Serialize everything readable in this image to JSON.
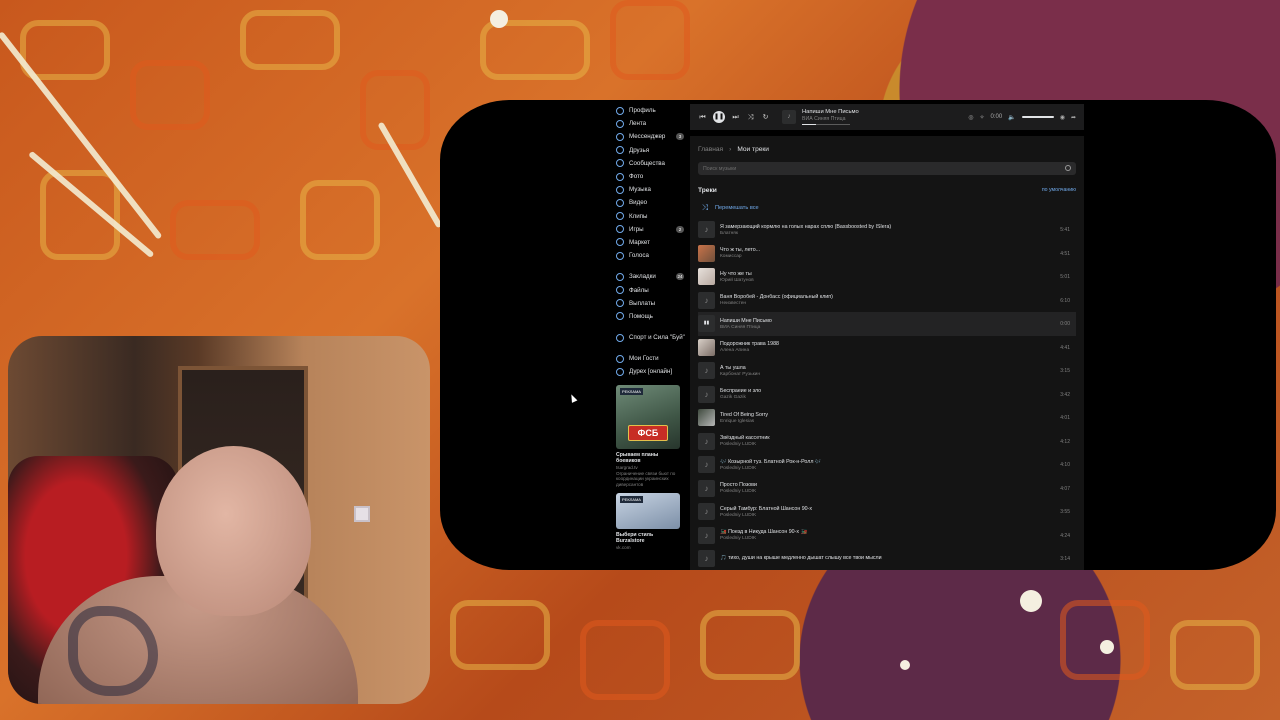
{
  "player": {
    "title": "Напиши Мне Письмо",
    "artist": "ВИА Синяя Птица",
    "time": "0:00",
    "progress": 0.3,
    "volume": 0.9
  },
  "nav": {
    "items": [
      {
        "label": "Профиль",
        "icon": "profile-icon",
        "count": ""
      },
      {
        "label": "Лента",
        "icon": "feed-icon",
        "count": ""
      },
      {
        "label": "Мессенджер",
        "icon": "messenger-icon",
        "count": "3"
      },
      {
        "label": "Друзья",
        "icon": "friends-icon",
        "count": ""
      },
      {
        "label": "Сообщества",
        "icon": "communities-icon",
        "count": ""
      },
      {
        "label": "Фото",
        "icon": "photo-icon",
        "count": ""
      },
      {
        "label": "Музыка",
        "icon": "music-icon",
        "count": ""
      },
      {
        "label": "Видео",
        "icon": "video-icon",
        "count": ""
      },
      {
        "label": "Клипы",
        "icon": "clips-icon",
        "count": ""
      },
      {
        "label": "Игры",
        "icon": "games-icon",
        "count": "2"
      },
      {
        "label": "Маркет",
        "icon": "market-icon",
        "count": ""
      },
      {
        "label": "Голоса",
        "icon": "votes-icon",
        "count": ""
      }
    ],
    "items2": [
      {
        "label": "Закладки",
        "icon": "bookmarks-icon",
        "count": "24"
      },
      {
        "label": "Файлы",
        "icon": "files-icon",
        "count": ""
      },
      {
        "label": "Выплаты",
        "icon": "payments-icon",
        "count": ""
      },
      {
        "label": "Помощь",
        "icon": "help-icon",
        "count": ""
      }
    ],
    "group1": {
      "label": "Спорт и Сила \"Буй\"",
      "icon": "group-icon"
    },
    "group2": [
      {
        "label": "Мои Гости",
        "icon": "app-icon"
      },
      {
        "label": "Дурех [онлайн]",
        "icon": "app-icon"
      }
    ]
  },
  "ads": [
    {
      "badge": "РЕКЛАМА",
      "image_text": "ФСБ",
      "title": "Срываем планы боевиков",
      "source": "tsargrad.tv",
      "desc": "Ограничение связи бьют по координации украинских диверсантов"
    },
    {
      "badge": "РЕКЛАМА",
      "title": "Выбери стиль Burzalstore",
      "source": "vk.com"
    }
  ],
  "breadcrumb": {
    "home": "Главная",
    "current": "Мои треки"
  },
  "search": {
    "placeholder": "Поиск музыки"
  },
  "section": {
    "title": "Треки",
    "sort": "по умолчанию"
  },
  "shuffle_label": "Перемешать все",
  "tracks": [
    {
      "title": "Я замерзающий кормлю на голых нарах сплю (Bassboosted by ISlera)",
      "artist": "Блатняк",
      "duration": "5:41",
      "cover": "note"
    },
    {
      "title": "Что ж ты, лето...",
      "artist": "Комиссар",
      "duration": "4:51",
      "cover": "img1"
    },
    {
      "title": "Ну что же ты",
      "artist": "Юрий Шатунов",
      "duration": "5:01",
      "cover": "img2"
    },
    {
      "title": "Ваня Воробей - Донбасс (официальный клип)",
      "artist": "Неизвестен",
      "duration": "6:10",
      "cover": "note"
    },
    {
      "title": "Напиши Мне Письмо",
      "artist": "ВИА Синяя Птица",
      "duration": "0:00",
      "cover": "playing",
      "active": true
    },
    {
      "title": "Подорожник трава 1988",
      "artist": "Алена Апина",
      "duration": "4:41",
      "cover": "img3"
    },
    {
      "title": "А ты ушла",
      "artist": "Карбонат Рузькин",
      "duration": "3:15",
      "cover": "note"
    },
    {
      "title": "Беспраеие и зло",
      "artist": "Gazik Gazik",
      "duration": "3:42",
      "cover": "note"
    },
    {
      "title": "Tired Of Being Sorry",
      "artist": "Enrique Iglesias",
      "duration": "4:01",
      "cover": "img4"
    },
    {
      "title": "Звёздный кассетник",
      "artist": "Posledniy LUDIK",
      "duration": "4:12",
      "cover": "note"
    },
    {
      "title": "🎶 Козырной туз. Блатной Рок-н-Ролл 🎶",
      "artist": "Posledniy LUDIK",
      "duration": "4:10",
      "cover": "note"
    },
    {
      "title": "Просто Позови",
      "artist": "Posledniy LUDIK",
      "duration": "4:07",
      "cover": "note"
    },
    {
      "title": "Серый Тамбур: Блатной Шансон 90-х",
      "artist": "Posledniy LUDIK",
      "duration": "3:55",
      "cover": "note"
    },
    {
      "title": "🚂 Поезд в Никуда Шансон 90-х 🚂",
      "artist": "Posledniy LUDIK",
      "duration": "4:24",
      "cover": "note"
    },
    {
      "title": "🎵 тихо, души на крыше медленно дышат слышу все твои мысли",
      "artist": "",
      "duration": "3:14",
      "cover": "note"
    }
  ]
}
